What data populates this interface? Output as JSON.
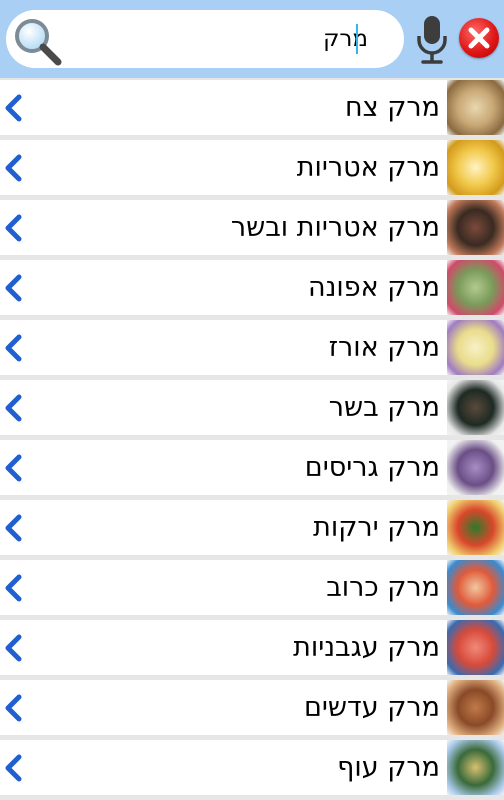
{
  "search": {
    "value": "מרק",
    "placeholder": ""
  },
  "icons": {
    "search": "magnifier-icon",
    "voice": "microphone-icon",
    "clear": "close-icon",
    "row_arrow": "chevron-left-icon"
  },
  "colors": {
    "header_bg": "#a9cff5",
    "chevron": "#1f5fd0",
    "clear_button": "#e01818"
  },
  "results": [
    {
      "label": "מרק צח",
      "thumb": [
        "#c9a776",
        "#e8d8b0",
        "#8a6a40"
      ]
    },
    {
      "label": "מרק אטריות",
      "thumb": [
        "#f2c94c",
        "#fff3c4",
        "#d39a1a"
      ]
    },
    {
      "label": "מרק אטריות ובשר",
      "thumb": [
        "#3a2a22",
        "#7b4a3a",
        "#c27a5a"
      ]
    },
    {
      "label": "מרק אפונה",
      "thumb": [
        "#7a9a5a",
        "#b3c98e",
        "#d04a6a"
      ]
    },
    {
      "label": "מרק אורז",
      "thumb": [
        "#e9dc8a",
        "#f7f0c8",
        "#a07cc0"
      ]
    },
    {
      "label": "מרק בשר",
      "thumb": [
        "#1e2a24",
        "#5a4a3a",
        "#e8e8e8"
      ]
    },
    {
      "label": "מרק גריסים",
      "thumb": [
        "#6a4e86",
        "#a88cc4",
        "#f0f0f0"
      ]
    },
    {
      "label": "מרק ירקות",
      "thumb": [
        "#d9472a",
        "#2e7a2a",
        "#f0d070"
      ]
    },
    {
      "label": "מרק כרוב",
      "thumb": [
        "#e05a3a",
        "#f0c8a0",
        "#3a8ad0"
      ]
    },
    {
      "label": "מרק עגבניות",
      "thumb": [
        "#d84a3a",
        "#f08a7a",
        "#3a6ab0"
      ]
    },
    {
      "label": "מרק עדשים",
      "thumb": [
        "#8a4a28",
        "#c07a48",
        "#e0b080"
      ]
    },
    {
      "label": "מרק עוף",
      "thumb": [
        "#3a6a3a",
        "#d8c070",
        "#a8c8e8"
      ]
    }
  ]
}
